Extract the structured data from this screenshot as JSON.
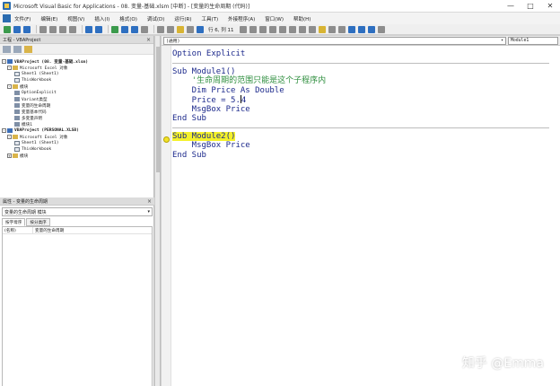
{
  "window": {
    "title": "Microsoft Visual Basic for Applications - 08. 变量-基础.xlsm [中断] - [变量的生命周期 (代码)]",
    "controls": [
      "—",
      "□",
      "✕"
    ]
  },
  "menubar": {
    "items": [
      "文件(F)",
      "编辑(E)",
      "视图(V)",
      "插入(I)",
      "格式(O)",
      "调试(D)",
      "运行(R)",
      "工具(T)",
      "外接程序(A)",
      "窗口(W)",
      "帮助(H)"
    ]
  },
  "toolbar": {
    "position": "行 6, 列 11"
  },
  "project_pane": {
    "title": "工程 - VBAProject",
    "close": "×",
    "tree": [
      {
        "toggle": "-",
        "icon": "proj",
        "label": "VBAProject (08. 变量-基础.xlsm)",
        "bold": true
      },
      {
        "toggle": "-",
        "icon": "folder",
        "label": "Microsoft Excel 对象"
      },
      {
        "toggle": "",
        "icon": "sheet",
        "label": "Sheet1 (Sheet1)"
      },
      {
        "toggle": "",
        "icon": "sheet",
        "label": "ThisWorkbook"
      },
      {
        "toggle": "-",
        "icon": "folder",
        "label": "模块"
      },
      {
        "toggle": "",
        "icon": "module",
        "label": "OptionExplicit"
      },
      {
        "toggle": "",
        "icon": "module",
        "label": "Variant类型"
      },
      {
        "toggle": "",
        "icon": "module",
        "label": "变量的生命周期"
      },
      {
        "toggle": "",
        "icon": "module",
        "label": "变量基本代码"
      },
      {
        "toggle": "",
        "icon": "module",
        "label": "多变量声明"
      },
      {
        "toggle": "",
        "icon": "module",
        "label": "模块1"
      },
      {
        "toggle": "-",
        "icon": "proj",
        "label": "VBAProject (PERSONAL.XLSB)",
        "bold": true
      },
      {
        "toggle": "-",
        "icon": "folder",
        "label": "Microsoft Excel 对象"
      },
      {
        "toggle": "",
        "icon": "sheet",
        "label": "Sheet1 (Sheet1)"
      },
      {
        "toggle": "",
        "icon": "sheet",
        "label": "ThisWorkbook"
      },
      {
        "toggle": "+",
        "icon": "folder",
        "label": "模块"
      }
    ]
  },
  "properties_pane": {
    "title": "属性 - 变量的生命周期",
    "close": "×",
    "object_combo": "变量的生命周期 模块",
    "tabs": [
      "按字母序",
      "按分类序"
    ],
    "rows": [
      {
        "name": "(名称)",
        "value": "变量的生命周期"
      }
    ]
  },
  "code_window": {
    "object_combo": "(通用)",
    "proc_combo": "Module1",
    "lines": [
      {
        "text": "Option Explicit",
        "kind": "code"
      },
      {
        "text": "",
        "kind": "sep"
      },
      {
        "text": "Sub Module1()",
        "kind": "code"
      },
      {
        "text": "    '生命周期的范围只能是这个子程序内",
        "kind": "comment"
      },
      {
        "text": "    Dim Price As Double",
        "kind": "code"
      },
      {
        "text": "    Price = 5.4",
        "kind": "code"
      },
      {
        "text": "    MsgBox Price",
        "kind": "code"
      },
      {
        "text": "End Sub",
        "kind": "code"
      },
      {
        "text": "",
        "kind": "sep"
      },
      {
        "text": "Sub Module2()",
        "kind": "highlight"
      },
      {
        "text": "    MsgBox Price",
        "kind": "code"
      },
      {
        "text": "End Sub",
        "kind": "code"
      }
    ]
  },
  "watermark": "知乎 @Emma",
  "colors": {
    "keyword": "#1d2a8c",
    "comment": "#2f8f3f",
    "highlight": "#f4f12a"
  }
}
